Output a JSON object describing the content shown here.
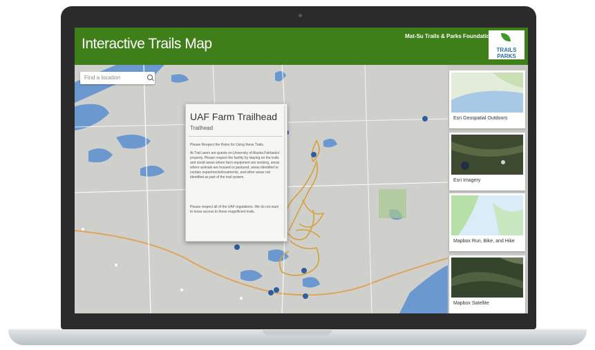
{
  "header": {
    "app_title": "Interactive Trails Map",
    "organization": "Mat-Su Trails & Parks Foundation",
    "logo_text": "TRAILS PARKS",
    "color": "#3f7f1a"
  },
  "search": {
    "placeholder": "Find a location"
  },
  "popup": {
    "title": "UAF Farm Trailhead",
    "type": "Trailhead",
    "paragraphs": [
      "Please Respect the Rules for Using these Trails.",
      "At Trail users are guests on University of Alaska Fairbanks' property. Please respect the facility by staying on the trails and avoid areas where farm equipment are working, areas where animals are housed or pastured, areas identified to contain experiments/treatments, and other areas not identified as part of the trail system.",
      "Please respect all of the UAF regulations. We do not want to loose access to these magnificent trails."
    ]
  },
  "basemaps": [
    {
      "label": "Esri Geospatial Outdoors",
      "icon": "outdoors-thumbnail"
    },
    {
      "label": "Esri Imagery",
      "icon": "imagery-thumbnail"
    },
    {
      "label": "Mapbox Run, Bike, and Hike",
      "icon": "run-bike-hike-thumbnail"
    },
    {
      "label": "Mapbox Satellite",
      "icon": "satellite-thumbnail"
    }
  ],
  "colors": {
    "trail": "#d4a13a",
    "water": "#5b8ec9",
    "marker": "#2f5d9e"
  }
}
